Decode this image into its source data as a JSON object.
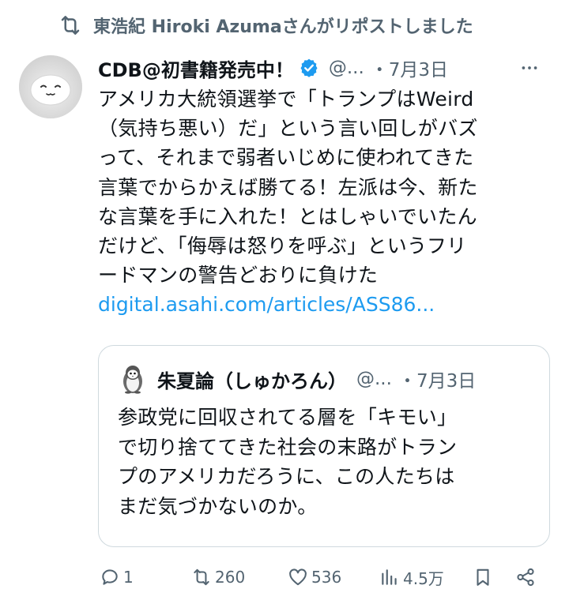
{
  "repost": {
    "text": "東浩紀 Hiroki Azumaさんがリポストしました"
  },
  "post": {
    "author_name": "CDB@初書籍発売中！",
    "handle": "@...",
    "date": "・7月3日",
    "lines": [
      "アメリカ大統領選挙で「トランプはWeird",
      "（気持ち悪い）だ」という言い回しがバズ",
      "って、それまで弱者いじめに使われてきた",
      "言葉でからかえば勝てる！左派は今、新た",
      "な言葉を手に入れた！とはしゃいでいたん",
      "だけど、「侮辱は怒りを呼ぶ」というフリ",
      "ードマンの警告どおりに負けた"
    ],
    "link": "digital.asahi.com/articles/ASS86..."
  },
  "quote": {
    "author_name": "朱夏論（しゅかろん）",
    "handle": "@...",
    "date": "・7月3日",
    "lines": [
      "参政党に回収されてる層を「キモい」",
      "で切り捨ててきた社会の末路がトラン",
      "プのアメリカだろうに、この人たちは",
      "まだ気づかないのか。"
    ]
  },
  "actions": {
    "reply_count": "1",
    "repost_count": "260",
    "like_count": "536",
    "views_count": "4.5万"
  },
  "icons": {
    "repost": "repost-icon",
    "verified": "verified-badge-icon",
    "more": "more-icon",
    "reply": "reply-icon",
    "like": "like-icon",
    "views": "views-icon",
    "bookmark": "bookmark-icon",
    "share": "share-icon"
  },
  "colors": {
    "text": "#0f1419",
    "secondary": "#536471",
    "link": "#1d9bf0",
    "border": "#cfd9de"
  }
}
